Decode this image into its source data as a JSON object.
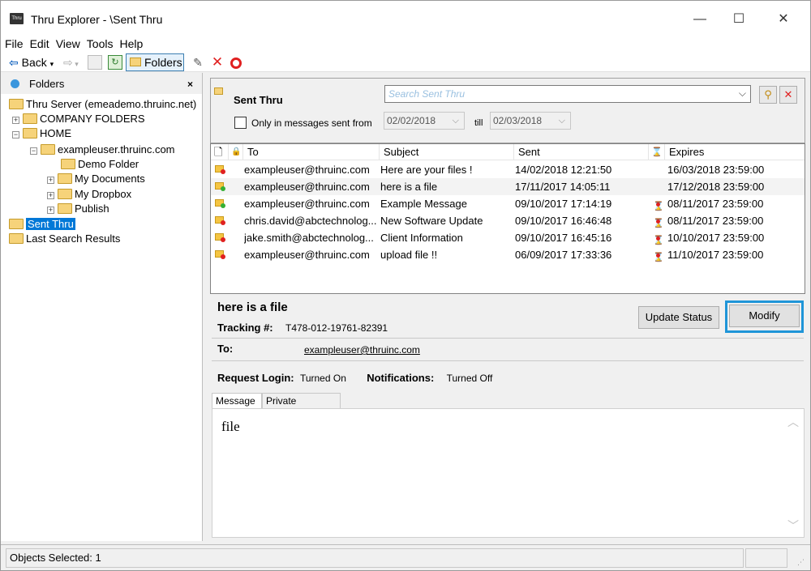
{
  "window": {
    "icon_text": "Thru",
    "title": "Thru Explorer - \\Sent Thru",
    "minimize": "—",
    "maximize": "☐",
    "close": "✕"
  },
  "menu": [
    "File",
    "Edit",
    "View",
    "Tools",
    "Help"
  ],
  "toolbar": {
    "back_label": "Back",
    "folders_label": "Folders"
  },
  "left_panel": {
    "header": "Folders",
    "close": "×",
    "tree": [
      {
        "label": "Thru Server (emeademo.thruinc.net)",
        "expander": ""
      },
      {
        "label": "COMPANY FOLDERS",
        "expander": "+"
      },
      {
        "label": "HOME",
        "expander": "−"
      },
      {
        "label": "exampleuser.thruinc.com",
        "expander": "−"
      },
      {
        "label": "Demo Folder",
        "expander": ""
      },
      {
        "label": "My Documents",
        "expander": "+"
      },
      {
        "label": "My Dropbox",
        "expander": "+"
      },
      {
        "label": "Publish",
        "expander": "+"
      },
      {
        "label": "Sent Thru",
        "expander": ""
      },
      {
        "label": "Last Search Results",
        "expander": ""
      }
    ]
  },
  "search": {
    "title": "Sent Thru",
    "placeholder": "Search Sent Thru",
    "checkbox_label": "Only in messages sent from",
    "from_date": "02/02/2018",
    "till_label": "till",
    "till_date": "02/03/2018"
  },
  "list": {
    "headers": {
      "to": "To",
      "subject": "Subject",
      "sent": "Sent",
      "expires": "Expires"
    },
    "rows": [
      {
        "to": "exampleuser@thruinc.com",
        "subject": "Here are your files !",
        "sent": "14/02/2018 12:21:50",
        "expires": "16/03/2018 23:59:00",
        "status": "red",
        "expired": false
      },
      {
        "to": "exampleuser@thruinc.com",
        "subject": "here is a file",
        "sent": "17/11/2017 14:05:11",
        "expires": "17/12/2018 23:59:00",
        "status": "green",
        "expired": false
      },
      {
        "to": "exampleuser@thruinc.com",
        "subject": "Example Message",
        "sent": "09/10/2017 17:14:19",
        "expires": "08/11/2017 23:59:00",
        "status": "green",
        "expired": true
      },
      {
        "to": "chris.david@abctechnolog...",
        "subject": "New Software Update",
        "sent": "09/10/2017 16:46:48",
        "expires": "08/11/2017 23:59:00",
        "status": "red",
        "expired": true
      },
      {
        "to": "jake.smith@abctechnolog...",
        "subject": "Client Information",
        "sent": "09/10/2017 16:45:16",
        "expires": "10/10/2017 23:59:00",
        "status": "red",
        "expired": true
      },
      {
        "to": "exampleuser@thruinc.com",
        "subject": "upload file !!",
        "sent": "06/09/2017 17:33:36",
        "expires": "11/10/2017 23:59:00",
        "status": "red",
        "expired": true
      }
    ]
  },
  "detail": {
    "title": "here is a file",
    "update_status": "Update Status",
    "modify": "Modify",
    "tracking_label": "Tracking #:",
    "tracking_value": "T478-012-19761-82391",
    "to_label": "To:",
    "to_value": "exampleuser@thruinc.com",
    "request_login_label": "Request Login:",
    "request_login_value": "Turned On",
    "notifications_label": "Notifications:",
    "notifications_value": "Turned Off",
    "tabs": [
      "Message",
      "Private Message"
    ],
    "message_text": "file"
  },
  "status": {
    "objects_selected": "Objects Selected: 1"
  }
}
